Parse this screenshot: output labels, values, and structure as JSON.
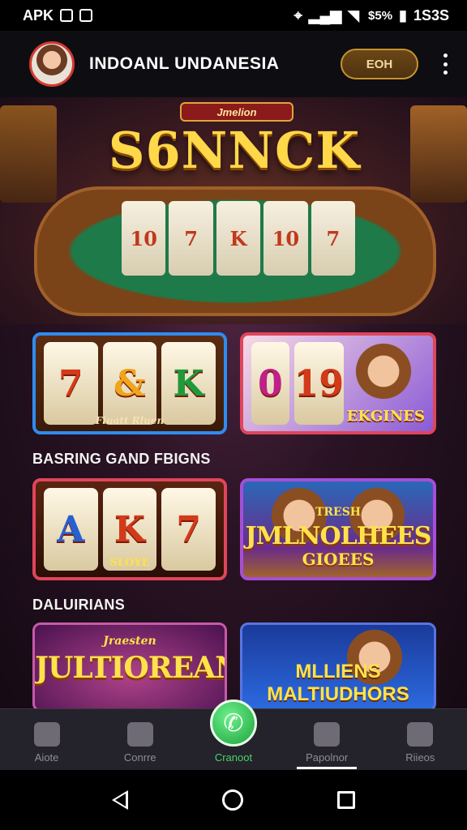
{
  "status_bar": {
    "left_label": "APK",
    "right_label": " $5%",
    "time": "1S3S"
  },
  "header": {
    "title": "INDOANL UNDANESIA",
    "action_label": "EOH"
  },
  "hero": {
    "title": "S6NNCK",
    "subtitle": "Jmelion",
    "reel_symbols": [
      "10",
      "7",
      "K",
      "10",
      "7"
    ]
  },
  "tiles": [
    {
      "reels": [
        "7",
        "&",
        "K"
      ],
      "label": "Fiuatt Rluen"
    },
    {
      "reels": [
        "0",
        "19"
      ],
      "label": "EKGINES"
    },
    {
      "reels": [
        "A",
        "K",
        "7"
      ],
      "label": "SLOYE"
    },
    {
      "label_top": "TRESH",
      "label": "JMLNOLHEES",
      "label_sub": "GIOEES"
    },
    {
      "label_top": "Jraesten",
      "label": "JULTIOREAN"
    },
    {
      "label": "MLLIENS MALTIUDHORS"
    }
  ],
  "sections": {
    "section_1": "BASRING GAND FBIGNS",
    "section_2": "DALUIRIANS"
  },
  "bottom_nav": {
    "items": [
      {
        "label": "Aiote"
      },
      {
        "label": "Conrre"
      },
      {
        "label": "Cranoot"
      },
      {
        "label": "Papolnor"
      },
      {
        "label": "Riieos"
      }
    ]
  },
  "colors": {
    "accent_green": "#4ad46a",
    "accent_gold": "#ffd84a",
    "header_button": "#6b4716"
  }
}
